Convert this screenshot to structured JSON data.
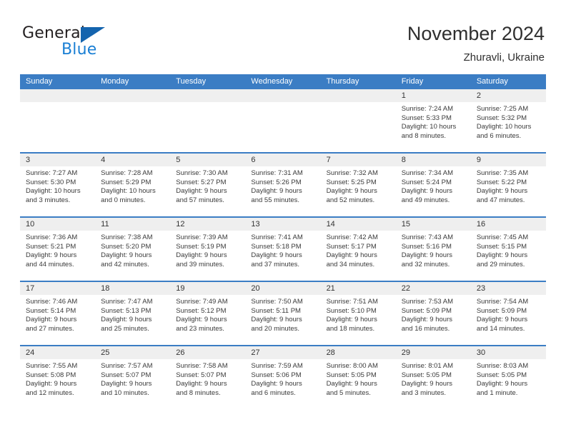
{
  "brand": {
    "name_part1": "General",
    "name_part2": "Blue",
    "triangle_color": "#1464ae",
    "blue_text_color": "#1a7fd4"
  },
  "header": {
    "title": "November 2024",
    "subtitle": "Zhuravli, Ukraine"
  },
  "colors": {
    "header_blue": "#3b7dc4",
    "daynum_band": "#efefef",
    "text": "#3a3a3a"
  },
  "weekday_headers": [
    "Sunday",
    "Monday",
    "Tuesday",
    "Wednesday",
    "Thursday",
    "Friday",
    "Saturday"
  ],
  "weeks": [
    [
      {
        "day": "",
        "empty": true
      },
      {
        "day": "",
        "empty": true
      },
      {
        "day": "",
        "empty": true
      },
      {
        "day": "",
        "empty": true
      },
      {
        "day": "",
        "empty": true
      },
      {
        "day": "1",
        "sunrise": "Sunrise: 7:24 AM",
        "sunset": "Sunset: 5:33 PM",
        "daylight1": "Daylight: 10 hours",
        "daylight2": "and 8 minutes."
      },
      {
        "day": "2",
        "sunrise": "Sunrise: 7:25 AM",
        "sunset": "Sunset: 5:32 PM",
        "daylight1": "Daylight: 10 hours",
        "daylight2": "and 6 minutes."
      }
    ],
    [
      {
        "day": "3",
        "sunrise": "Sunrise: 7:27 AM",
        "sunset": "Sunset: 5:30 PM",
        "daylight1": "Daylight: 10 hours",
        "daylight2": "and 3 minutes."
      },
      {
        "day": "4",
        "sunrise": "Sunrise: 7:28 AM",
        "sunset": "Sunset: 5:29 PM",
        "daylight1": "Daylight: 10 hours",
        "daylight2": "and 0 minutes."
      },
      {
        "day": "5",
        "sunrise": "Sunrise: 7:30 AM",
        "sunset": "Sunset: 5:27 PM",
        "daylight1": "Daylight: 9 hours",
        "daylight2": "and 57 minutes."
      },
      {
        "day": "6",
        "sunrise": "Sunrise: 7:31 AM",
        "sunset": "Sunset: 5:26 PM",
        "daylight1": "Daylight: 9 hours",
        "daylight2": "and 55 minutes."
      },
      {
        "day": "7",
        "sunrise": "Sunrise: 7:32 AM",
        "sunset": "Sunset: 5:25 PM",
        "daylight1": "Daylight: 9 hours",
        "daylight2": "and 52 minutes."
      },
      {
        "day": "8",
        "sunrise": "Sunrise: 7:34 AM",
        "sunset": "Sunset: 5:24 PM",
        "daylight1": "Daylight: 9 hours",
        "daylight2": "and 49 minutes."
      },
      {
        "day": "9",
        "sunrise": "Sunrise: 7:35 AM",
        "sunset": "Sunset: 5:22 PM",
        "daylight1": "Daylight: 9 hours",
        "daylight2": "and 47 minutes."
      }
    ],
    [
      {
        "day": "10",
        "sunrise": "Sunrise: 7:36 AM",
        "sunset": "Sunset: 5:21 PM",
        "daylight1": "Daylight: 9 hours",
        "daylight2": "and 44 minutes."
      },
      {
        "day": "11",
        "sunrise": "Sunrise: 7:38 AM",
        "sunset": "Sunset: 5:20 PM",
        "daylight1": "Daylight: 9 hours",
        "daylight2": "and 42 minutes."
      },
      {
        "day": "12",
        "sunrise": "Sunrise: 7:39 AM",
        "sunset": "Sunset: 5:19 PM",
        "daylight1": "Daylight: 9 hours",
        "daylight2": "and 39 minutes."
      },
      {
        "day": "13",
        "sunrise": "Sunrise: 7:41 AM",
        "sunset": "Sunset: 5:18 PM",
        "daylight1": "Daylight: 9 hours",
        "daylight2": "and 37 minutes."
      },
      {
        "day": "14",
        "sunrise": "Sunrise: 7:42 AM",
        "sunset": "Sunset: 5:17 PM",
        "daylight1": "Daylight: 9 hours",
        "daylight2": "and 34 minutes."
      },
      {
        "day": "15",
        "sunrise": "Sunrise: 7:43 AM",
        "sunset": "Sunset: 5:16 PM",
        "daylight1": "Daylight: 9 hours",
        "daylight2": "and 32 minutes."
      },
      {
        "day": "16",
        "sunrise": "Sunrise: 7:45 AM",
        "sunset": "Sunset: 5:15 PM",
        "daylight1": "Daylight: 9 hours",
        "daylight2": "and 29 minutes."
      }
    ],
    [
      {
        "day": "17",
        "sunrise": "Sunrise: 7:46 AM",
        "sunset": "Sunset: 5:14 PM",
        "daylight1": "Daylight: 9 hours",
        "daylight2": "and 27 minutes."
      },
      {
        "day": "18",
        "sunrise": "Sunrise: 7:47 AM",
        "sunset": "Sunset: 5:13 PM",
        "daylight1": "Daylight: 9 hours",
        "daylight2": "and 25 minutes."
      },
      {
        "day": "19",
        "sunrise": "Sunrise: 7:49 AM",
        "sunset": "Sunset: 5:12 PM",
        "daylight1": "Daylight: 9 hours",
        "daylight2": "and 23 minutes."
      },
      {
        "day": "20",
        "sunrise": "Sunrise: 7:50 AM",
        "sunset": "Sunset: 5:11 PM",
        "daylight1": "Daylight: 9 hours",
        "daylight2": "and 20 minutes."
      },
      {
        "day": "21",
        "sunrise": "Sunrise: 7:51 AM",
        "sunset": "Sunset: 5:10 PM",
        "daylight1": "Daylight: 9 hours",
        "daylight2": "and 18 minutes."
      },
      {
        "day": "22",
        "sunrise": "Sunrise: 7:53 AM",
        "sunset": "Sunset: 5:09 PM",
        "daylight1": "Daylight: 9 hours",
        "daylight2": "and 16 minutes."
      },
      {
        "day": "23",
        "sunrise": "Sunrise: 7:54 AM",
        "sunset": "Sunset: 5:09 PM",
        "daylight1": "Daylight: 9 hours",
        "daylight2": "and 14 minutes."
      }
    ],
    [
      {
        "day": "24",
        "sunrise": "Sunrise: 7:55 AM",
        "sunset": "Sunset: 5:08 PM",
        "daylight1": "Daylight: 9 hours",
        "daylight2": "and 12 minutes."
      },
      {
        "day": "25",
        "sunrise": "Sunrise: 7:57 AM",
        "sunset": "Sunset: 5:07 PM",
        "daylight1": "Daylight: 9 hours",
        "daylight2": "and 10 minutes."
      },
      {
        "day": "26",
        "sunrise": "Sunrise: 7:58 AM",
        "sunset": "Sunset: 5:07 PM",
        "daylight1": "Daylight: 9 hours",
        "daylight2": "and 8 minutes."
      },
      {
        "day": "27",
        "sunrise": "Sunrise: 7:59 AM",
        "sunset": "Sunset: 5:06 PM",
        "daylight1": "Daylight: 9 hours",
        "daylight2": "and 6 minutes."
      },
      {
        "day": "28",
        "sunrise": "Sunrise: 8:00 AM",
        "sunset": "Sunset: 5:05 PM",
        "daylight1": "Daylight: 9 hours",
        "daylight2": "and 5 minutes."
      },
      {
        "day": "29",
        "sunrise": "Sunrise: 8:01 AM",
        "sunset": "Sunset: 5:05 PM",
        "daylight1": "Daylight: 9 hours",
        "daylight2": "and 3 minutes."
      },
      {
        "day": "30",
        "sunrise": "Sunrise: 8:03 AM",
        "sunset": "Sunset: 5:05 PM",
        "daylight1": "Daylight: 9 hours",
        "daylight2": "and 1 minute."
      }
    ]
  ]
}
